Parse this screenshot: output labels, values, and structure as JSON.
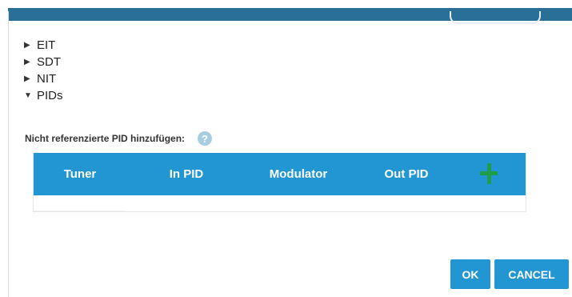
{
  "tree": {
    "items": [
      {
        "label": "EIT",
        "expanded": false,
        "arrow": "▶"
      },
      {
        "label": "SDT",
        "expanded": false,
        "arrow": "▶"
      },
      {
        "label": "NIT",
        "expanded": false,
        "arrow": "▶"
      },
      {
        "label": "PIDs",
        "expanded": true,
        "arrow": "▼"
      }
    ]
  },
  "pids": {
    "add_label": "Nicht referenzierte PID hinzufügen:",
    "help_icon": "?",
    "table": {
      "columns": [
        "Tuner",
        "In PID",
        "Modulator",
        "Out PID"
      ],
      "rows": []
    }
  },
  "buttons": {
    "ok_label": "OK",
    "cancel_label": "CANCEL"
  },
  "colors": {
    "accent": "#2196d3",
    "header_strip": "#2a6f97",
    "add_green": "#1e9e4a",
    "help_blue": "#a8cde3"
  }
}
